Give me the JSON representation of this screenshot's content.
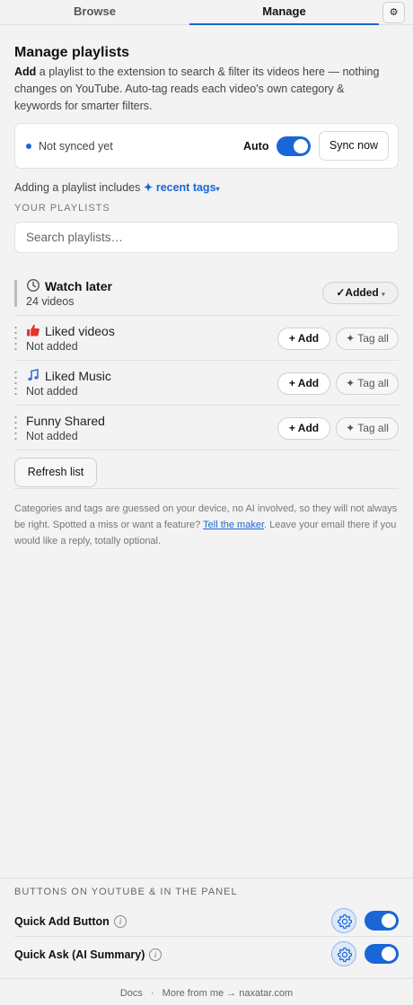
{
  "tabs": {
    "browse": "Browse",
    "manage": "Manage",
    "settings_glyph": "⚙"
  },
  "header": {
    "title": "Manage playlists",
    "desc_bold": "Add",
    "desc_rest": " a playlist to the extension to search & filter its videos here — nothing changes on YouTube. Auto-tag reads each video's own category & keywords for smarter filters."
  },
  "sync": {
    "status": "Not synced yet",
    "auto_label": "Auto",
    "auto_on": true,
    "button": "Sync now"
  },
  "includes": {
    "prefix": "Adding a playlist includes",
    "spark": "✦",
    "tags_label": "recent tags",
    "caret": "▾"
  },
  "playlists_section": {
    "label": "YOUR PLAYLISTS",
    "search_placeholder": "Search playlists…"
  },
  "playlists": [
    {
      "title": "Watch later",
      "subtitle": "24 videos",
      "icon": "clock-icon",
      "status": "added",
      "added_label": "✓Added",
      "added_caret": "▾"
    },
    {
      "title": "Liked videos",
      "subtitle": "Not added",
      "icon": "thumbs-up-icon",
      "status": "not-added",
      "add_label": "+ Add",
      "tag_label": "✦ Tag all"
    },
    {
      "title": "Liked Music",
      "subtitle": "Not added",
      "icon": "music-note-icon",
      "status": "not-added",
      "add_label": "+ Add",
      "tag_label": "✦ Tag all"
    },
    {
      "title": "Funny Shared",
      "subtitle": "Not added",
      "icon": "",
      "status": "not-added",
      "add_label": "+ Add",
      "tag_label": "✦ Tag all"
    }
  ],
  "refresh_button": "Refresh list",
  "note": {
    "text_before": "Categories and tags are guessed on your device, no AI involved, so they will not always be right. Spotted a miss or want a feature? ",
    "link": "Tell the maker",
    "text_after": ". Leave your email there if you would like a reply, totally optional."
  },
  "bottom_panel": {
    "label": "BUTTONS ON YOUTUBE & IN THE PANEL",
    "rows": [
      {
        "title": "Quick Add Button",
        "info": "i",
        "enabled": true
      },
      {
        "title": "Quick Ask (AI Summary)",
        "info": "i",
        "enabled": true
      }
    ]
  },
  "footer": {
    "docs": "Docs",
    "sep": "·",
    "more": "More from me → naxatar.com"
  },
  "colors": {
    "accent": "#1a66d6",
    "background": "#f3f3f3",
    "like_icon": "#e0352b"
  }
}
